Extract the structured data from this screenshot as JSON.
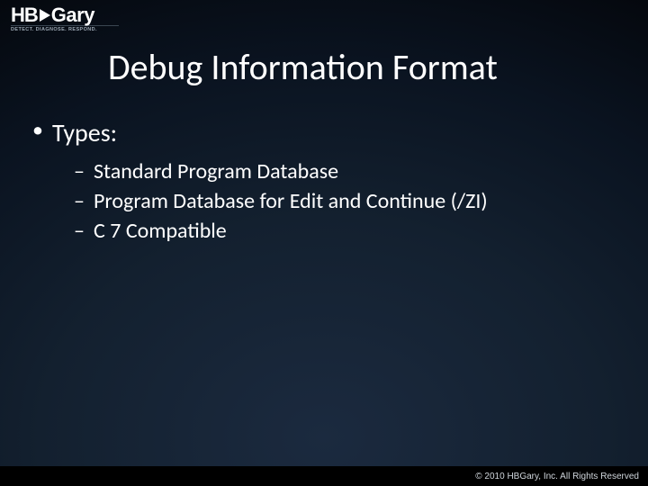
{
  "logo": {
    "hb": "HB",
    "gary": "Gary",
    "tagline": "DETECT. DIAGNOSE. RESPOND."
  },
  "title": "Debug Information Format",
  "bullets": {
    "level1_0": "Types:",
    "level2_0": "Standard Program Database",
    "level2_1": "Program Database for Edit and Continue (/ZI)",
    "level2_2": "C 7 Compatible"
  },
  "footer": {
    "copyright": "© 2010 HBGary, Inc. All Rights Reserved"
  }
}
